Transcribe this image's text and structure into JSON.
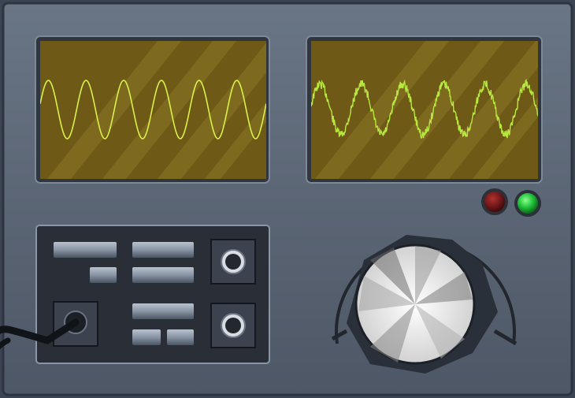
{
  "colors": {
    "panel": "#5a6576",
    "screen": "#6e5a16",
    "trace": "#d8f24a",
    "trace_noisy": "#b8e840",
    "led_red": "#7a1010",
    "led_green": "#25c040"
  },
  "screens": [
    {
      "name": "clean-sine",
      "cycles": 6,
      "noise": 0
    },
    {
      "name": "noisy-sine",
      "cycles": 5.5,
      "noise": 0.35
    }
  ],
  "indicators": [
    {
      "name": "red-led",
      "state": "off"
    },
    {
      "name": "green-led",
      "state": "on"
    }
  ],
  "control_panel": {
    "buttons": [
      "slider-1",
      "slider-2",
      "slider-3",
      "slider-4",
      "slider-5",
      "slider-6",
      "slider-7"
    ],
    "jacks": [
      "jack-top",
      "jack-bottom",
      "jack-plugged"
    ]
  },
  "dial": {
    "name": "tuning-knob"
  }
}
